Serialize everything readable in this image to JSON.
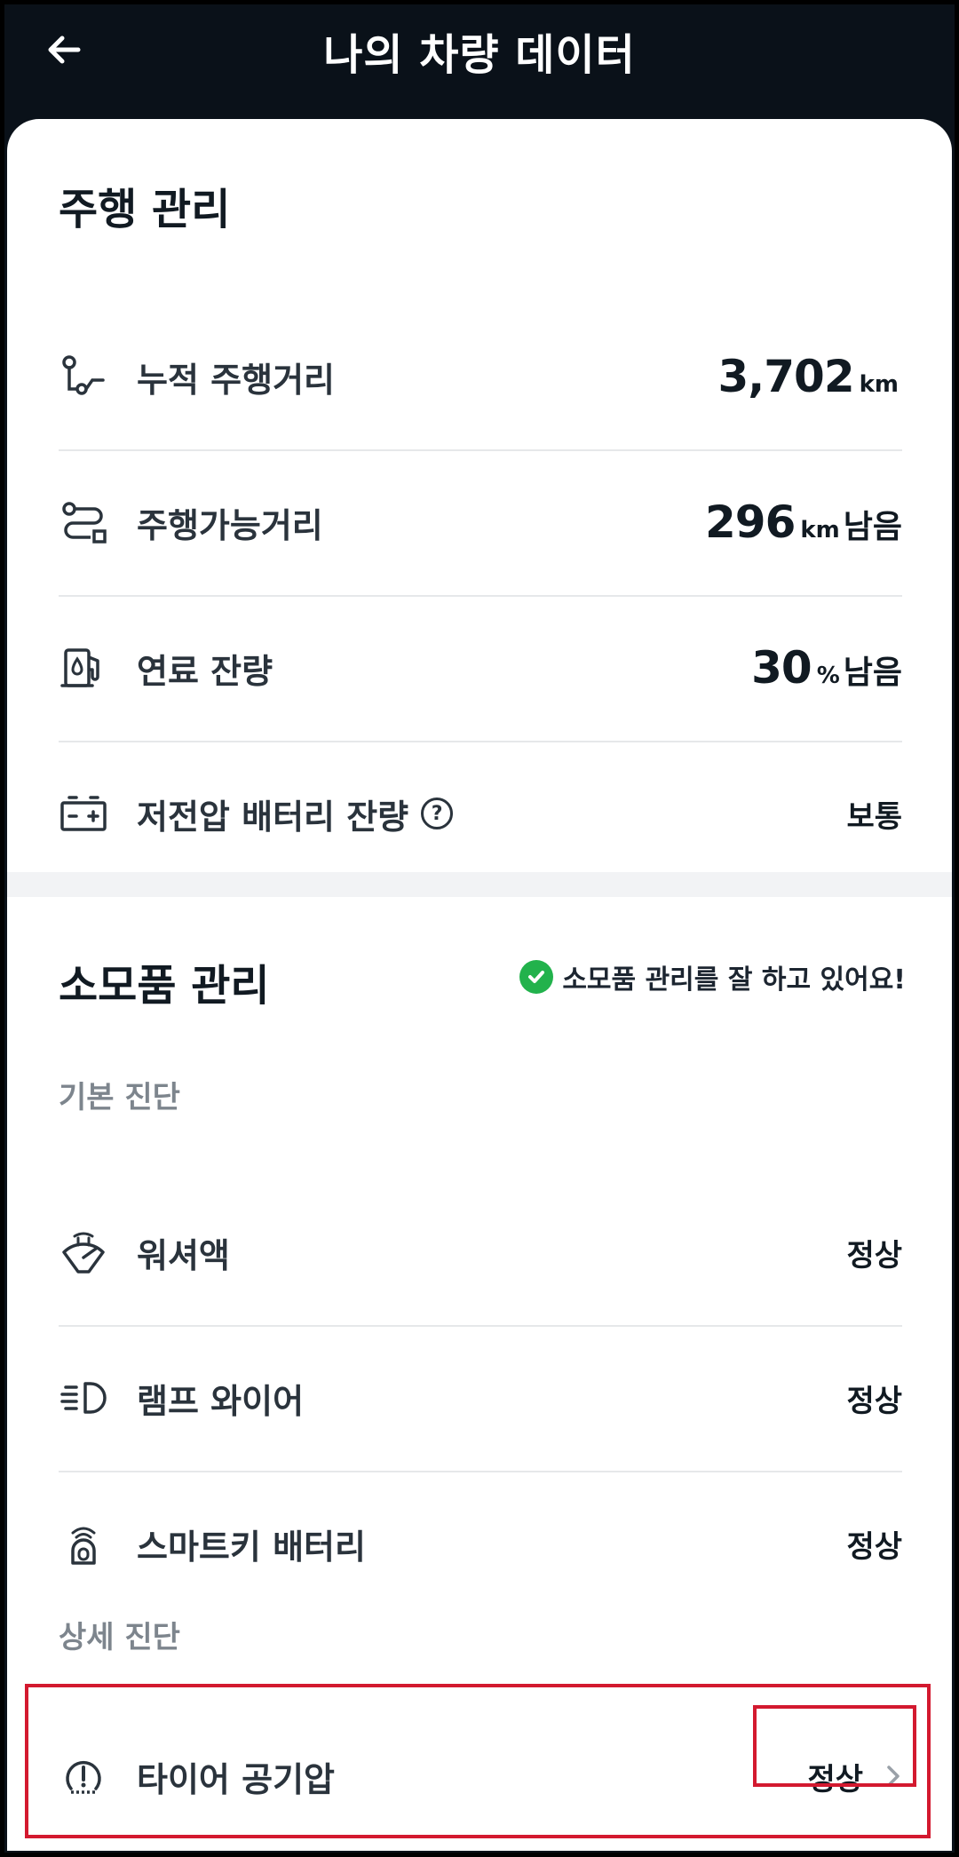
{
  "header": {
    "title": "나의 차량 데이터"
  },
  "driving": {
    "title": "주행 관리",
    "rows": [
      {
        "label": "누적 주행거리",
        "value": "3,702",
        "unit": "km",
        "suffix": ""
      },
      {
        "label": "주행가능거리",
        "value": "296",
        "unit": "km",
        "suffix": "남음"
      },
      {
        "label": "연료 잔량",
        "value": "30",
        "unit": "%",
        "suffix": "남음"
      },
      {
        "label": "저전압 배터리 잔량",
        "value": "보통"
      }
    ]
  },
  "consumables": {
    "title": "소모품 관리",
    "badge": "소모품 관리를 잘 하고 있어요!",
    "basic_heading": "기본 진단",
    "basic_rows": [
      {
        "label": "워셔액",
        "status": "정상"
      },
      {
        "label": "램프 와이어",
        "status": "정상"
      },
      {
        "label": "스마트키 배터리",
        "status": "정상"
      }
    ],
    "detail_heading": "상세 진단",
    "detail_rows": [
      {
        "label": "타이어 공기압",
        "status": "정상"
      }
    ]
  },
  "colors": {
    "header_bg": "#0a1119",
    "accent_green": "#22b24c",
    "highlight": "#d3192f"
  },
  "icons": [
    "back-arrow-icon",
    "odometer-icon",
    "route-icon",
    "fuel-pump-icon",
    "battery-icon",
    "help-icon",
    "check-circle-icon",
    "washer-fluid-icon",
    "headlamp-icon",
    "smart-key-icon",
    "tire-pressure-icon",
    "chevron-right-icon"
  ]
}
